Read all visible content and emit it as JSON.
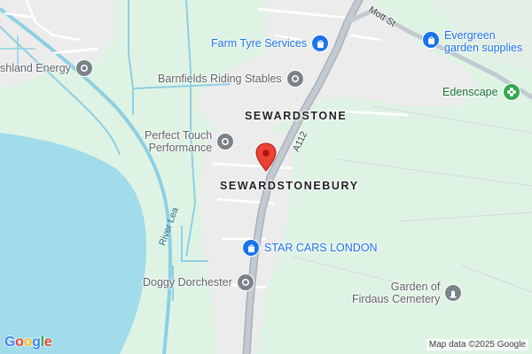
{
  "map": {
    "places": {
      "sewardstone": "SEWARDSTONE",
      "sewardstonebury": "SEWARDSTONEBURY"
    },
    "roads": {
      "a112": "A112",
      "mott_st": "Mott St"
    },
    "river": "River Lea",
    "pois": {
      "farm_tyre": "Farm Tyre Services",
      "evergreen_line1": "Evergreen",
      "evergreen_line2": "garden supplies",
      "marshland": "shland Energy",
      "barnfields": "Barnfields Riding Stables",
      "edenscape": "Edenscape",
      "perfect_touch_line1": "Perfect Touch",
      "perfect_touch_line2": "Performance",
      "star_cars": "STAR CARS LONDON",
      "doggy": "Doggy Dorchester",
      "firdaus_line1": "Garden of",
      "firdaus_line2": "Firdaus Cemetery"
    },
    "icons": {
      "shopping": "shopping-bag-icon",
      "generic": "place-icon",
      "garden": "flower-icon",
      "cemetery": "cemetery-icon",
      "marker": "location-marker-icon"
    },
    "colors": {
      "land": "#dff3e4",
      "water": "#a0dcea",
      "road": "#b9c0c8",
      "built": "#ececec",
      "marker": "#ea4335"
    },
    "logo": "Google",
    "attribution": "Map data ©2025 Google"
  }
}
